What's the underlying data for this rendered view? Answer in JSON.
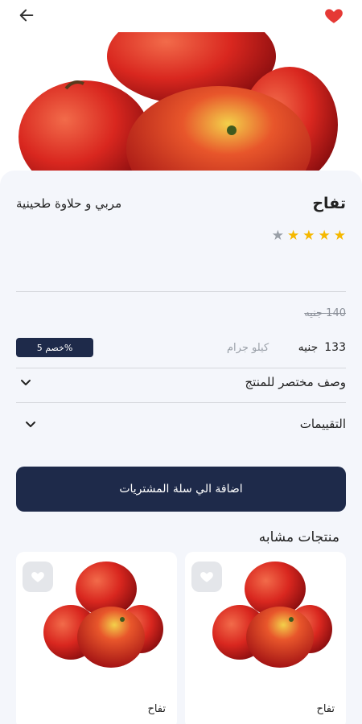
{
  "topbar": {
    "back_icon": "arrow-left-icon",
    "favorite_icon": "heart-icon",
    "favorite_color": "#e53935"
  },
  "product": {
    "name": "تفاح",
    "brand": "مربي و حلاوة طحينية",
    "rating": 4,
    "rating_max": 5,
    "star_color": "#f5b800",
    "star_empty_color": "#9aa0a8",
    "old_price": "140 جنيه",
    "price_value": "133",
    "price_currency": "جنيه",
    "unit": "كيلو جرام",
    "discount": "%خصم 5"
  },
  "accordion": {
    "description_label": "وصف مختصر للمنتج",
    "reviews_label": "التقييمات"
  },
  "cart_button": {
    "label": "اضافة الي سلة المشتريات",
    "color": "#1e2a4a"
  },
  "similar": {
    "title": "منتجات مشابه",
    "items": [
      {
        "name": "تفاح"
      },
      {
        "name": "تفاح"
      }
    ]
  }
}
